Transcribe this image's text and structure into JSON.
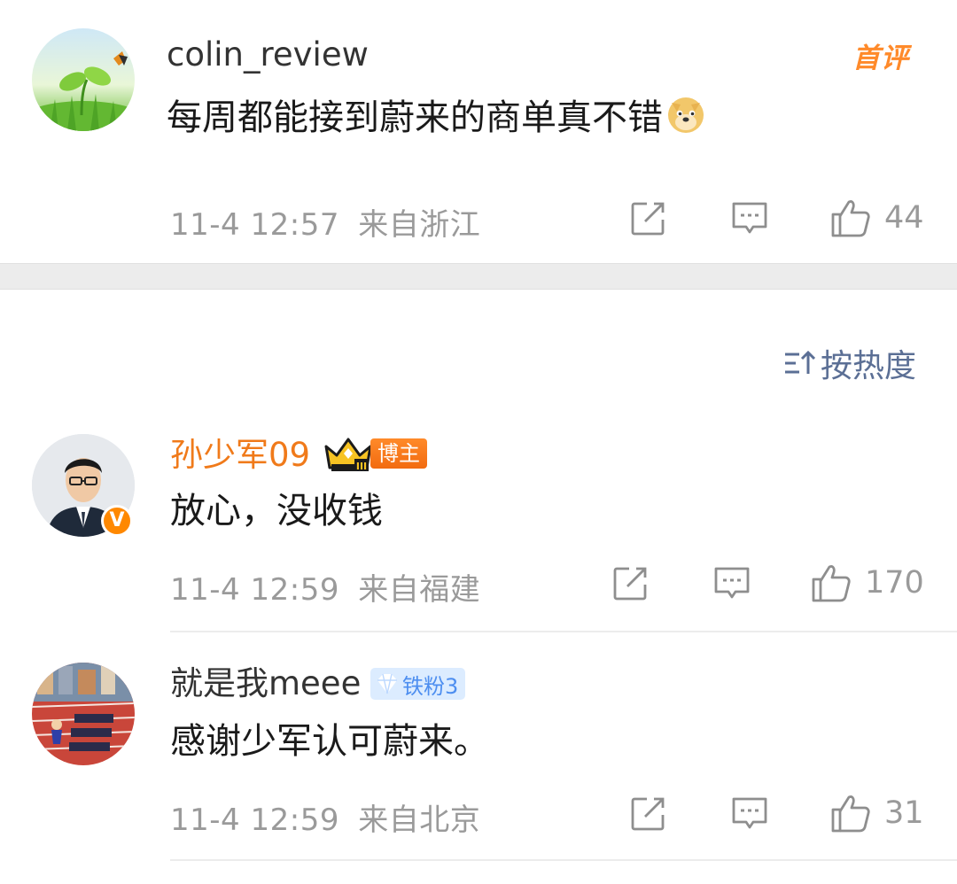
{
  "comments_top": {
    "username": "colin_review",
    "content": "每周都能接到蔚来的商单真不错",
    "emoji": "doge-emoji",
    "badge": "首评",
    "timestamp": "11-4 12:57",
    "location": "来自浙江",
    "likes": "44"
  },
  "sort": {
    "label": "按热度",
    "icon": "sort-icon"
  },
  "comments": [
    {
      "username": "孙少军09",
      "badge_label": "博主",
      "content": "放心，没收钱",
      "timestamp": "11-4 12:59",
      "location": "来自福建",
      "likes": "170",
      "verified": "V"
    },
    {
      "username": "就是我meee",
      "badge_label": "铁粉3",
      "content": "感谢少军认可蔚来。",
      "timestamp": "11-4 12:59",
      "location": "来自北京",
      "likes": "31"
    }
  ],
  "colors": {
    "accent_orange": "#ff8a2a",
    "author_name": "#f07a1a",
    "meta_gray": "#9a9a9a",
    "link_blue": "#5b6f95"
  }
}
